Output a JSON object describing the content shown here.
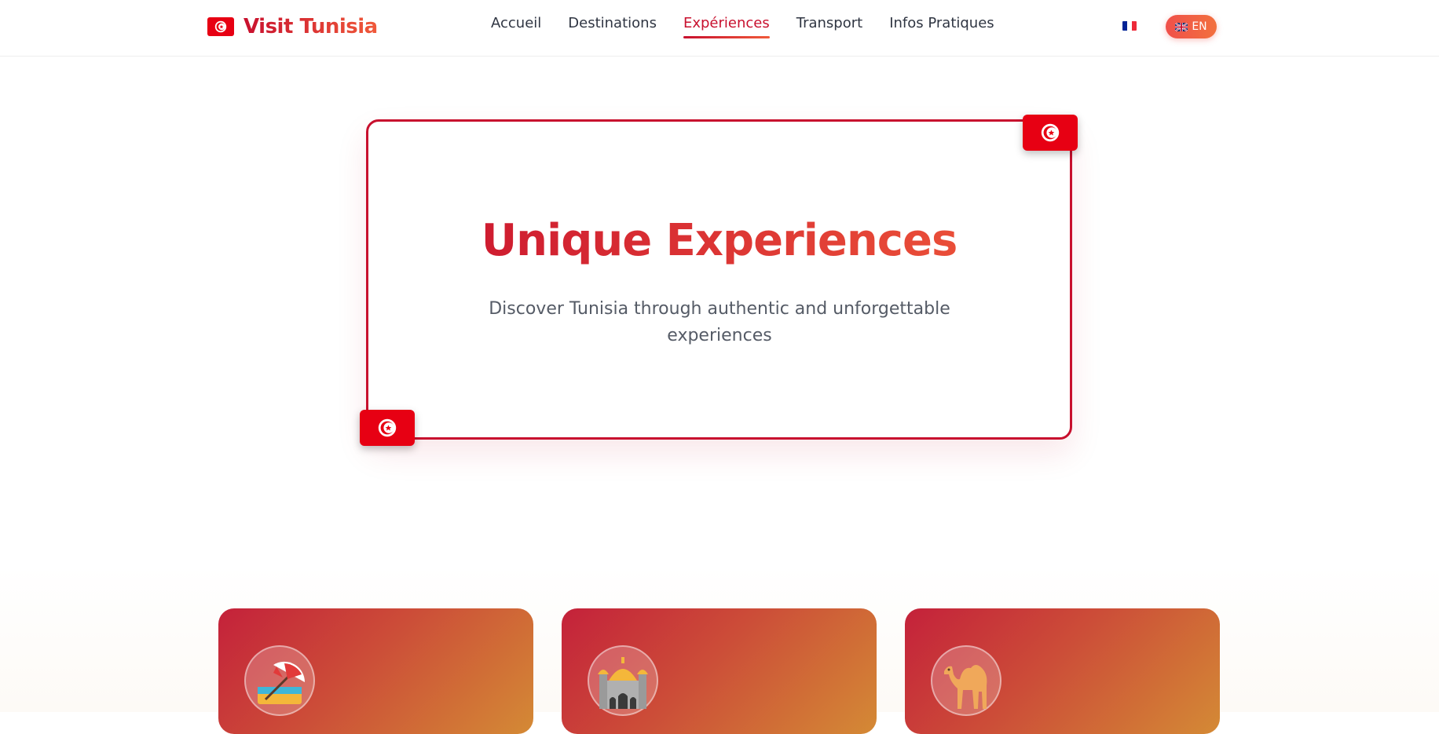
{
  "brand": {
    "name": "Visit Tunisia",
    "icon": "tunisia-flag-icon"
  },
  "nav": {
    "items": [
      {
        "label": "Accueil",
        "active": false
      },
      {
        "label": "Destinations",
        "active": false
      },
      {
        "label": "Expériences",
        "active": true
      },
      {
        "label": "Transport",
        "active": false
      },
      {
        "label": "Infos Pratiques",
        "active": false
      }
    ]
  },
  "language": {
    "fr_icon": "french-flag-icon",
    "en_label": "EN",
    "en_icon": "uk-flag-icon"
  },
  "hero": {
    "title": "Unique Experiences",
    "subtitle": "Discover Tunisia through authentic and unforgettable experiences",
    "decor_icon": "tunisia-flag-icon"
  },
  "experiences": [
    {
      "icon": "beach-umbrella-icon"
    },
    {
      "icon": "mosque-icon"
    },
    {
      "icon": "camel-icon"
    }
  ],
  "colors": {
    "brand_red": "#c8102e",
    "brand_orange": "#f05a3a",
    "flag_red": "#e70013",
    "text_dark": "#2f3542",
    "text_muted": "#555b66"
  }
}
